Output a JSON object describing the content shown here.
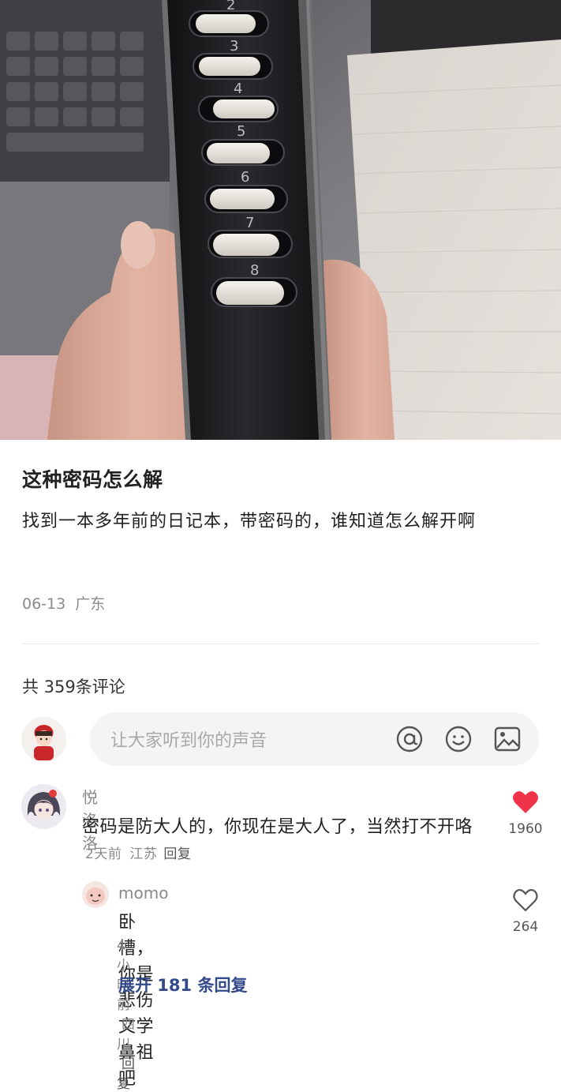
{
  "post": {
    "title": "这种密码怎么解",
    "body": "找到一本多年前的日记本，带密码的，谁知道怎么解开啊",
    "date": "06-13",
    "location": "广东"
  },
  "photo": {
    "lock_digits": [
      "2",
      "3",
      "4",
      "5",
      "6",
      "7",
      "8"
    ]
  },
  "comments_header": {
    "count_label": "共 359条评论"
  },
  "comment_input": {
    "placeholder": "让大家听到你的声音",
    "icons": [
      "at-icon",
      "emoji-icon",
      "image-icon"
    ]
  },
  "comments": [
    {
      "user": "悦洛洛",
      "text": "密码是防大人的，你现在是大人了，当然打不开咯",
      "time": "2天前",
      "location": "江苏",
      "reply_label": "回复",
      "likes": "1960",
      "liked": true,
      "replies": [
        {
          "user": "momo",
          "text": "卧槽，你是悲伤文学鼻祖吧",
          "time": "4小时前",
          "location": "四川",
          "reply_label": "回复",
          "likes": "264",
          "liked": false
        }
      ],
      "expand_label": "展开 181 条回复"
    }
  ],
  "colors": {
    "like_active": "#f0334a",
    "expand_link": "#334a8a",
    "meta_gray": "#8a8a8a"
  }
}
